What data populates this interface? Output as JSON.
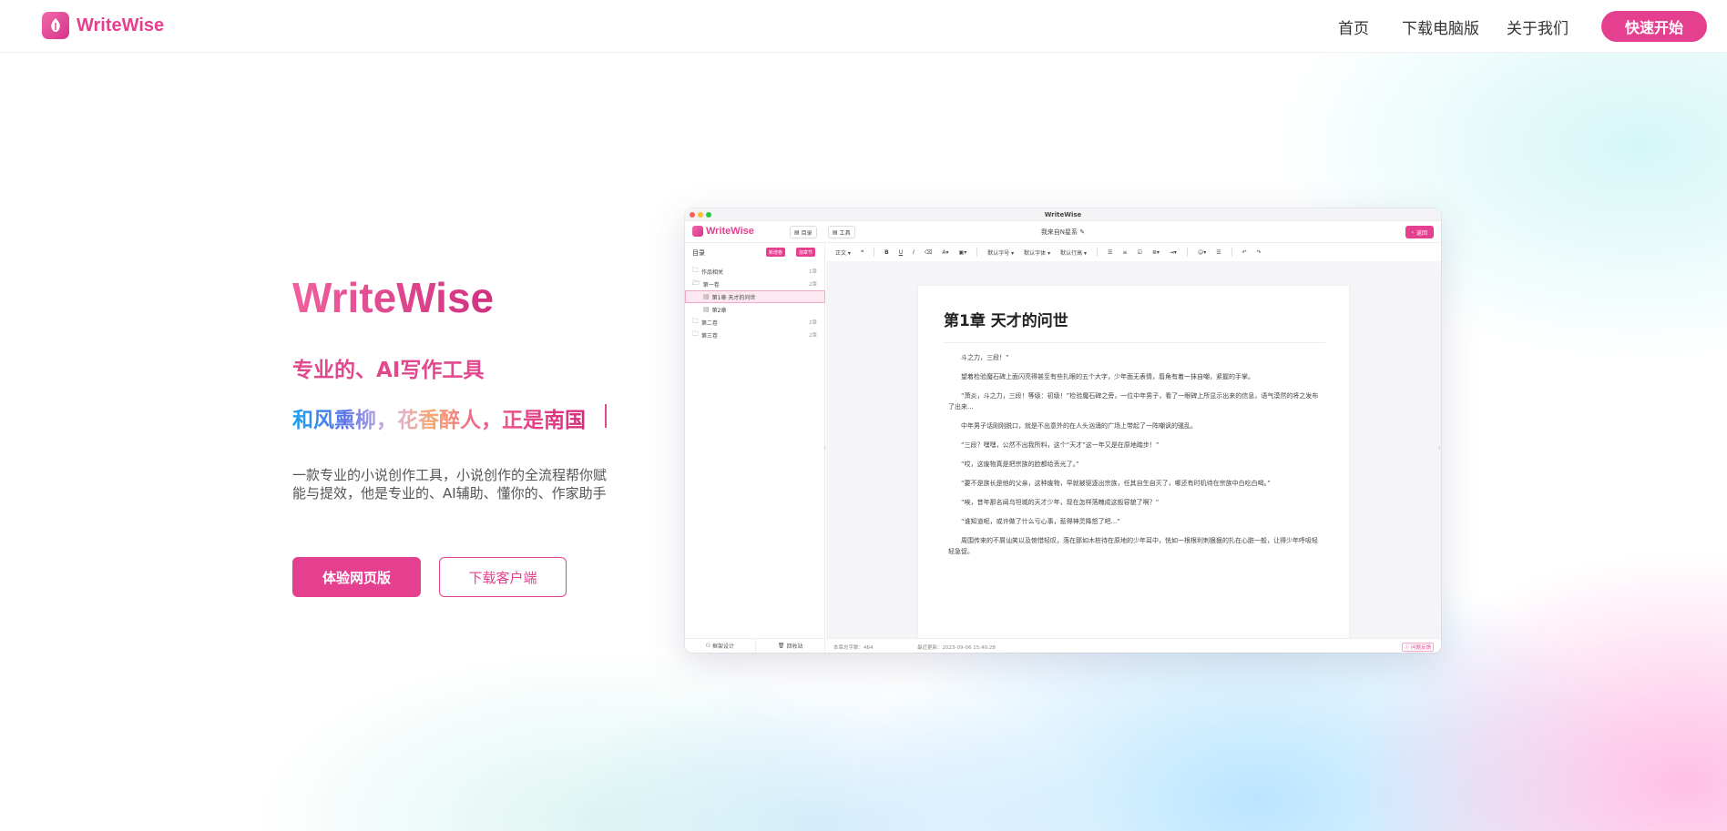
{
  "header": {
    "logo_text": "WriteWise",
    "nav": [
      {
        "label": "首页"
      },
      {
        "label": "下载电脑版"
      },
      {
        "label": "关于我们"
      }
    ],
    "cta_label": "快速开始"
  },
  "hero": {
    "title": "WriteWise",
    "subtitle": "专业的、AI写作工具",
    "poem": "和风熏柳，花香醉人，正是南国",
    "description": "一款专业的小说创作工具，小说创作的全流程帮你赋能与提效，他是专业的、AI辅助、懂你的、作家助手",
    "primary_button": "体验网页版",
    "secondary_button": "下载客户端"
  },
  "app_preview": {
    "window_title": "WriteWise",
    "logo_text": "WriteWise",
    "chips": [
      "目录",
      "工具"
    ],
    "book_title": "我来自N星系",
    "back_label": "返回",
    "sidebar": {
      "heading": "目录",
      "new_volume": "新增卷",
      "add_chapter": "加章节",
      "tree": [
        {
          "label": "作品相关",
          "count": "1章",
          "type": "folder",
          "level": 0
        },
        {
          "label": "第一卷",
          "count": "2章",
          "type": "folder-open",
          "level": 0
        },
        {
          "label": "第1章 天才的问世",
          "count": "",
          "type": "file",
          "level": 1,
          "active": true
        },
        {
          "label": "第2章",
          "count": "",
          "type": "file",
          "level": 1
        },
        {
          "label": "第二卷",
          "count": "2章",
          "type": "folder",
          "level": 0
        },
        {
          "label": "第三卷",
          "count": "2章",
          "type": "folder",
          "level": 0
        }
      ],
      "footer": [
        "框架设计",
        "回收站"
      ]
    },
    "toolbar": {
      "paragraph": "正文",
      "font_size": "默认字号",
      "font_family": "默认字体",
      "line_height": "默认行高"
    },
    "chapter_title": "第1章 天才的问世",
    "paragraphs": [
      "斗之力，三段！”",
      "望着检验魔石碑上面闪亮得甚至有些扎眼的五个大字，少年面无表情，唇角有着一抹自嘲，紧握的手掌。",
      "“萧炎，斗之力，三段！等级：初级！”检验魔石碑之旁，一位中年男子，看了一眼碑上所显示出来的信息，语气漠然的将之发布了出来...",
      "中年男子话刚刚脱口，就是不出意外的在人头汹涌的广场上带起了一阵嘲讽的骚乱。",
      "“三段？嘿嘿，公然不出我所料，这个“天才”这一年又是在原地踏步！”",
      "“哎，这废物真是把宗族的脸都给丢光了。”",
      "“要不是族长是他的父亲，这种废物，早就被驱逐出宗族，任其自生自灭了，哪还有时机待在宗族中白吃白喝。”",
      "“唉，昔年那名闻乌坦城的天才少年，现在怎样落魄成这般容貌了啊？”",
      "“谁知道呢，或许做了什么亏心事，惹得神灵降怒了吧...”",
      "周围传来的不屑讪笑以及惋惜轻叹，落在那如木桩待在原地的少年耳中，恍如一根根利刺狠狠的扎在心脏一般，让得少年呼吸轻轻急促。"
    ],
    "status": {
      "word_count": "本章总字数：464",
      "updated": "最近更新：2023-09-06 15:40:28",
      "feedback": "问题反馈"
    }
  },
  "colors": {
    "brand": "#e53f8f",
    "brand_light": "#f06aa8"
  }
}
